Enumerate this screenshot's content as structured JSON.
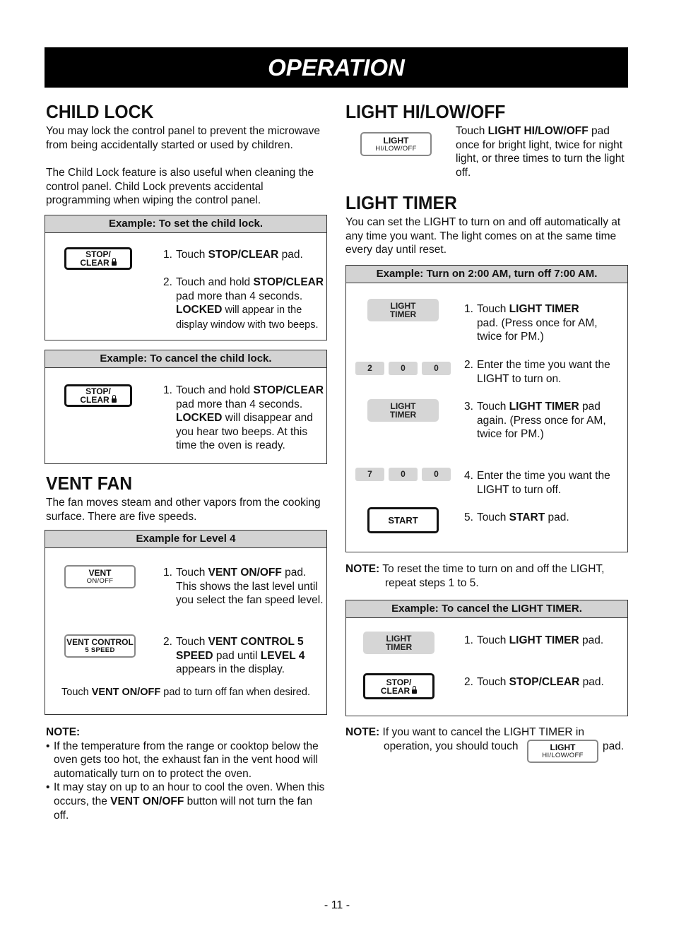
{
  "banner": {
    "title": "OPERATION"
  },
  "child_lock": {
    "heading": "CHILD LOCK",
    "intro_1": "You may lock the control panel to prevent the microwave from being accidentally started or used by children.",
    "intro_2": "The Child Lock feature is also useful when cleaning the control panel. Child Lock prevents accidental programming when wiping the control panel.",
    "set_example": {
      "header": "Example: To set the child lock.",
      "pad": {
        "line1": "STOP/",
        "line2": "CLEAR",
        "icon": "lock-icon"
      },
      "steps": [
        {
          "num": "1.",
          "pre": "Touch ",
          "bold": "STOP/CLEAR",
          "post": " pad."
        },
        {
          "num": "2.",
          "pre": "Touch and hold ",
          "bold": "STOP/CLEAR",
          "mid": " pad more than 4 seconds. ",
          "bold2": "LOCKED",
          "post": " will appear in the display window with two beeps."
        }
      ]
    },
    "cancel_example": {
      "header": "Example: To cancel the child lock.",
      "pad": {
        "line1": "STOP/",
        "line2": "CLEAR",
        "icon": "lock-icon"
      },
      "steps": [
        {
          "num": "1.",
          "pre": "Touch and hold ",
          "bold": "STOP/CLEAR",
          "mid": " pad more than 4 seconds. ",
          "bold2": "LOCKED",
          "post": " will disappear and you hear two beeps. At this time the oven is ready."
        }
      ]
    }
  },
  "vent_fan": {
    "heading": "VENT FAN",
    "intro": "The fan moves steam and other vapors from the cooking surface. There are five speeds.",
    "example": {
      "header": "Example for Level 4",
      "pad1": {
        "line1": "VENT",
        "line2": "ON/OFF"
      },
      "pad2": {
        "line1": "VENT CONTROL",
        "line2": "5 SPEED"
      },
      "steps": [
        {
          "num": "1.",
          "pre": "Touch ",
          "bold": "VENT ON/OFF",
          "post": " pad. This shows the last level until you select the fan speed level."
        },
        {
          "num": "2.",
          "pre": "Touch ",
          "bold": "VENT CONTROL 5 SPEED",
          "mid": " pad until ",
          "bold2": "LEVEL 4",
          "post": " appears in the display."
        }
      ],
      "footer": {
        "pre": "Touch ",
        "bold": "VENT ON/OFF",
        "post": " pad to turn off fan when desired."
      }
    },
    "note": {
      "label": "NOTE:",
      "bullet_1": "If the temperature from the range or cooktop below the oven gets too hot, the exhaust fan in the vent hood will automatically turn on to protect the oven.",
      "bullet_2_pre": "It may stay on up to an hour to cool the oven. When this occurs, the ",
      "bullet_2_bold": "VENT ON/OFF",
      "bullet_2_post": " button will not turn the fan off."
    }
  },
  "light_hilowoff": {
    "heading": "LIGHT HI/LOW/OFF",
    "pad": {
      "line1": "LIGHT",
      "line2": "HI/LOW/OFF"
    },
    "text_pre": "Touch ",
    "text_bold": "LIGHT HI/LOW/OFF",
    "text_post": " pad once for bright light, twice for night light, or three times to turn the light off."
  },
  "light_timer": {
    "heading": "LIGHT TIMER",
    "intro": "You can set the LIGHT to turn on and off automatically at any time you want. The light comes on at the same time every day until reset.",
    "example": {
      "header": "Example: Turn on 2:00 AM, turn off 7:00 AM.",
      "timer_pad": {
        "line1": "LIGHT",
        "line2": "TIMER"
      },
      "keys_on": [
        "2",
        "0",
        "0"
      ],
      "keys_off": [
        "7",
        "0",
        "0"
      ],
      "start_pad": "START",
      "steps": [
        {
          "num": "1.",
          "pre": "Touch ",
          "bold": "LIGHT TIMER",
          "post": " pad. (Press once for AM, twice for PM.)"
        },
        {
          "num": "2.",
          "text": "Enter the time you want the LIGHT to turn on."
        },
        {
          "num": "3.",
          "pre": "Touch ",
          "bold": "LIGHT TIMER",
          "post": " pad again. (Press once for AM,   twice for PM.)"
        },
        {
          "num": "4.",
          "text": "Enter the time you want the LIGHT to turn off."
        },
        {
          "num": "5.",
          "pre": "Touch ",
          "bold": "START",
          "post": " pad."
        }
      ]
    },
    "note_reset": {
      "label": "NOTE:",
      "text": " To reset the time to turn on and off the LIGHT, repeat steps 1 to 5."
    },
    "cancel_example": {
      "header": "Example: To cancel the LIGHT TIMER.",
      "timer_pad": {
        "line1": "LIGHT",
        "line2": "TIMER"
      },
      "stop_pad": {
        "line1": "STOP/",
        "line2": "CLEAR"
      },
      "steps": [
        {
          "num": "1.",
          "pre": "Touch ",
          "bold": "LIGHT TIMER",
          "post": " pad."
        },
        {
          "num": "2.",
          "pre": "Touch ",
          "bold": "STOP/CLEAR",
          "post": " pad."
        }
      ]
    },
    "note_cancel": {
      "label": "NOTE:",
      "text": " If you want to cancel the LIGHT TIMER in",
      "text2": "operation, you should touch",
      "pad": {
        "line1": "LIGHT",
        "line2": "HI/LOW/OFF"
      },
      "text3": "pad."
    }
  },
  "footer": {
    "page_number": "- 11 -"
  },
  "colors": {
    "banner_bg": "#000000",
    "header_bg": "#d3d3d3",
    "pad_fill": "#d6d6d6"
  }
}
